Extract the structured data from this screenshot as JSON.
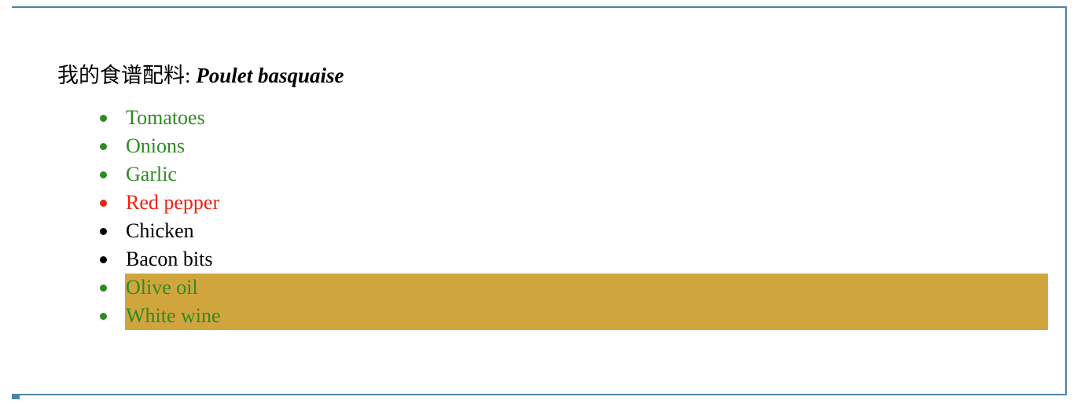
{
  "document": {
    "frame_color": "#4e85a5",
    "background_color": "#ffffff"
  },
  "title": {
    "lead": "我的食谱配料: ",
    "dish": "Poulet basquaise"
  },
  "palette": {
    "green": "#2e8b22",
    "red": "#ee2211",
    "black": "#000000",
    "highlight_gold": "#d1a53e"
  },
  "ingredients": [
    {
      "label": "Tomatoes",
      "color": "green",
      "bullet": "disc",
      "highlighted": false
    },
    {
      "label": "Onions",
      "color": "green",
      "bullet": "disc",
      "highlighted": false
    },
    {
      "label": "Garlic",
      "color": "green",
      "bullet": "disc",
      "highlighted": false
    },
    {
      "label": "Red pepper",
      "color": "red",
      "bullet": "disc",
      "highlighted": false
    },
    {
      "label": "Chicken",
      "color": "black",
      "bullet": "disc",
      "highlighted": false
    },
    {
      "label": "Bacon bits",
      "color": "black",
      "bullet": "disc",
      "highlighted": false
    },
    {
      "label": "Olive oil",
      "color": "green",
      "bullet": "disc",
      "highlighted": true
    },
    {
      "label": "White wine",
      "color": "green",
      "bullet": "disc",
      "highlighted": true
    }
  ]
}
